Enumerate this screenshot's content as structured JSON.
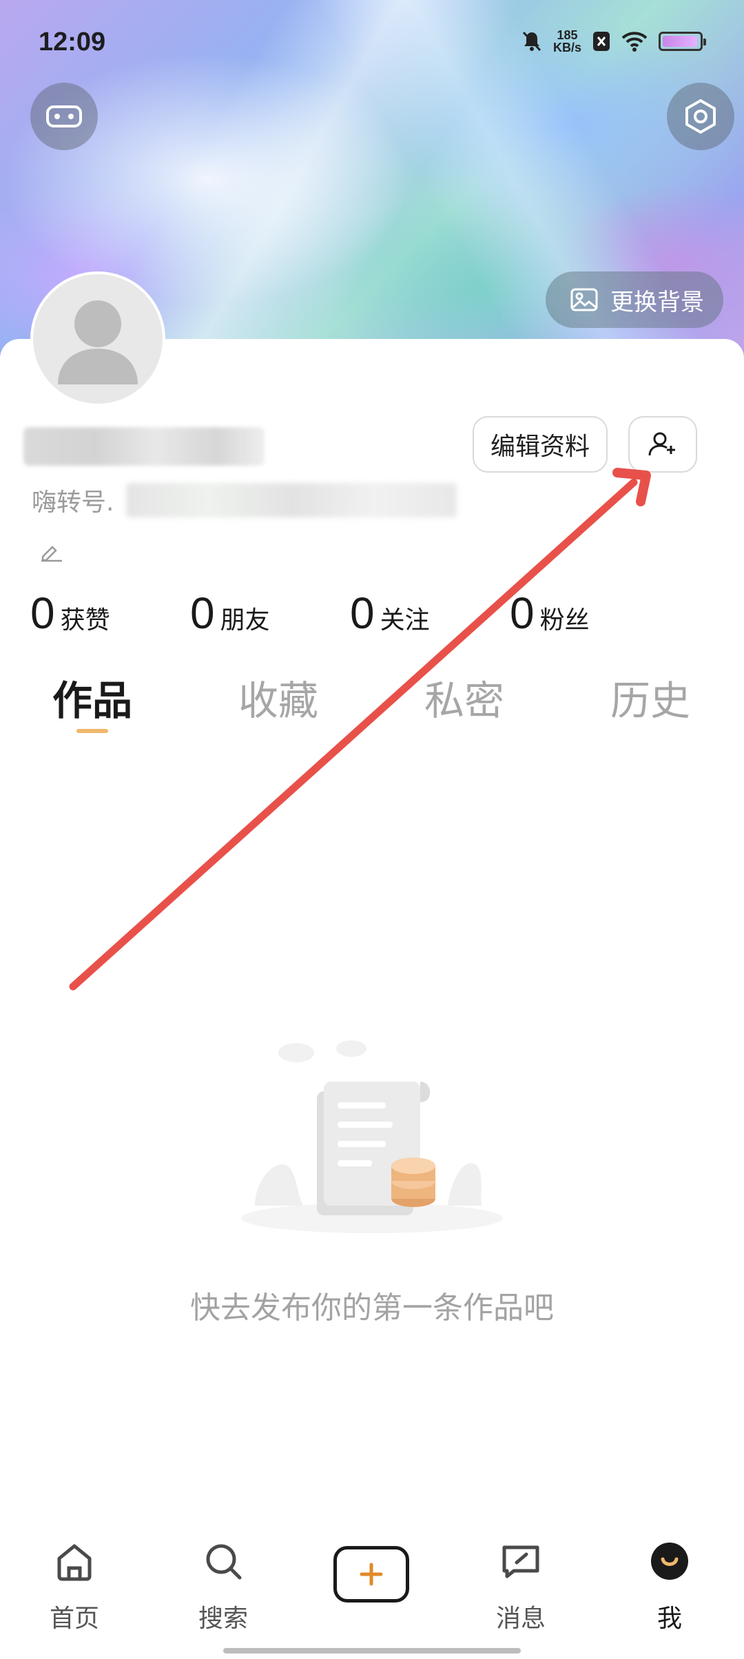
{
  "status_bar": {
    "time": "12:09",
    "net_speed_value": "185",
    "net_speed_unit": "KB/s"
  },
  "header": {
    "change_background_label": "更换背景"
  },
  "profile": {
    "edit_profile_label": "编辑资料",
    "id_prefix": "嗨转号.",
    "stats": [
      {
        "value": "0",
        "label": "获赞"
      },
      {
        "value": "0",
        "label": "朋友"
      },
      {
        "value": "0",
        "label": "关注"
      },
      {
        "value": "0",
        "label": "粉丝"
      }
    ]
  },
  "tabs": [
    {
      "label": "作品",
      "active": true
    },
    {
      "label": "收藏",
      "active": false
    },
    {
      "label": "私密",
      "active": false
    },
    {
      "label": "历史",
      "active": false
    }
  ],
  "empty_state": {
    "message": "快去发布你的第一条作品吧"
  },
  "bottom_nav": [
    {
      "label": "首页",
      "icon": "home-icon"
    },
    {
      "label": "搜索",
      "icon": "search-icon"
    },
    {
      "label": "",
      "icon": "plus-icon"
    },
    {
      "label": "消息",
      "icon": "message-icon"
    },
    {
      "label": "我",
      "icon": "me-avatar-icon"
    }
  ],
  "colors": {
    "accent": "#f0b86b",
    "annotation_arrow": "#e8514a",
    "plus": "#e08a2a"
  }
}
